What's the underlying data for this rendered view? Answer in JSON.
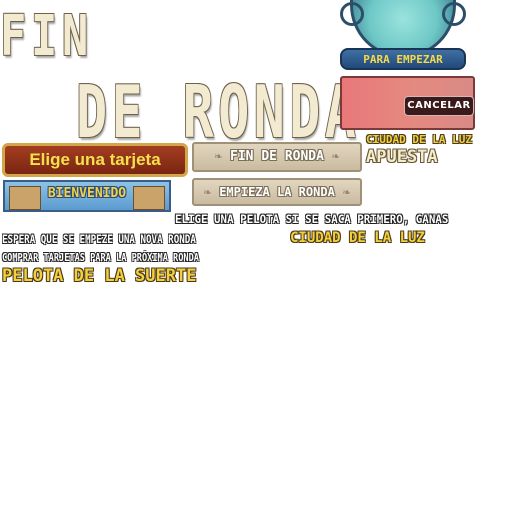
{
  "title": {
    "line1": "FIN",
    "line2": "DE RONDA"
  },
  "bubble": {
    "button_label": "PARA EMPEZAR"
  },
  "cancel_panel": {
    "button_label": "CANCELAR"
  },
  "buttons": {
    "elige_tarjeta": "Elige una tarjeta",
    "fin_ronda": "FIN DE RONDA",
    "empieza_ronda": "EMPIEZA LA RONDA"
  },
  "banner": {
    "bienvenido": "BIENVENIDO"
  },
  "labels": {
    "ciudad_small": "CIUDAD DE LA LUZ",
    "apuesta": "APUESTA",
    "elige_pelota": "ELIGE UNA PELOTA SI SE SACA PRIMERO, GANAS",
    "espera": "ESPERA QUE SE EMPEZE UNA NOVA RONDA",
    "ciudad_large": "CIUDAD DE LA LUZ",
    "comprar": "COMPRAR TARJETAS PARA LA PRÓXIMA RONDA",
    "pelota_suerte": "PELOTA DE LA SUERTE"
  },
  "colors": {
    "title_fill": "#f3ead2",
    "accent_yellow": "#f3cf3c",
    "button_red": "#a33d20",
    "cancel_panel": "#e9787a",
    "bubble_teal": "#6ec8c6"
  }
}
